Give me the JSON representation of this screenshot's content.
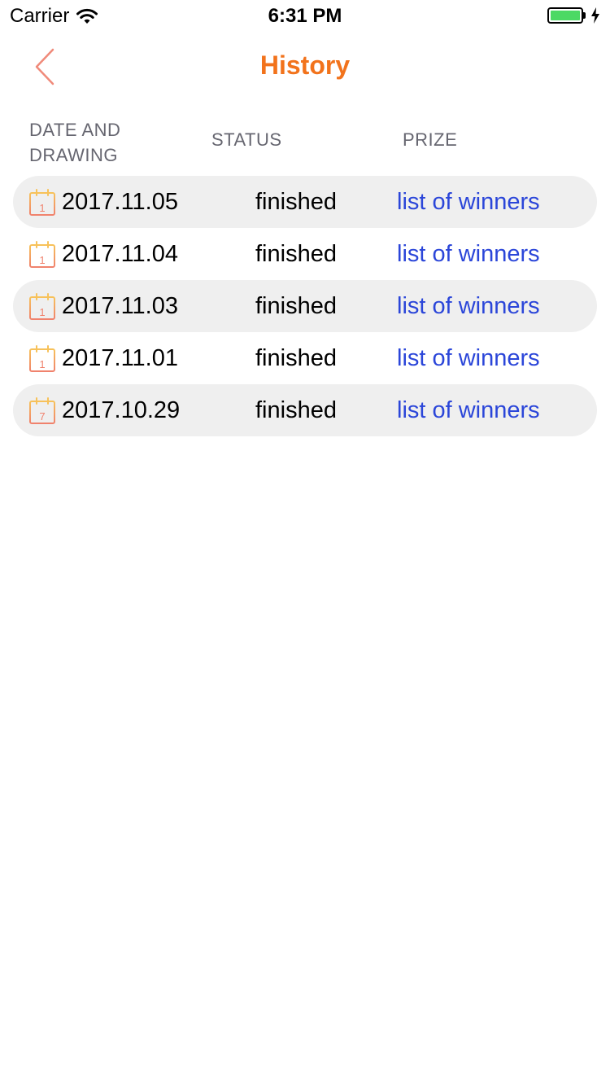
{
  "status_bar": {
    "carrier": "Carrier",
    "time": "6:31 PM",
    "battery_level": 1.0,
    "battery_color": "#4cd964"
  },
  "nav": {
    "title": "History",
    "back_icon": "chevron-left-icon",
    "accent_color": "#f2731c"
  },
  "table": {
    "headers": {
      "date": "DATE AND DRAWING",
      "status": "STATUS",
      "prize": "PRIZE"
    },
    "rows": [
      {
        "date": "2017.11.05",
        "icon_day": "1",
        "status": "finished",
        "link": "list of winners"
      },
      {
        "date": "2017.11.04",
        "icon_day": "1",
        "status": "finished",
        "link": "list of winners"
      },
      {
        "date": "2017.11.03",
        "icon_day": "1",
        "status": "finished",
        "link": "list of winners"
      },
      {
        "date": "2017.11.01",
        "icon_day": "1",
        "status": "finished",
        "link": "list of winners"
      },
      {
        "date": "2017.10.29",
        "icon_day": "7",
        "status": "finished",
        "link": "list of winners"
      }
    ],
    "link_color": "#2b46d9"
  }
}
